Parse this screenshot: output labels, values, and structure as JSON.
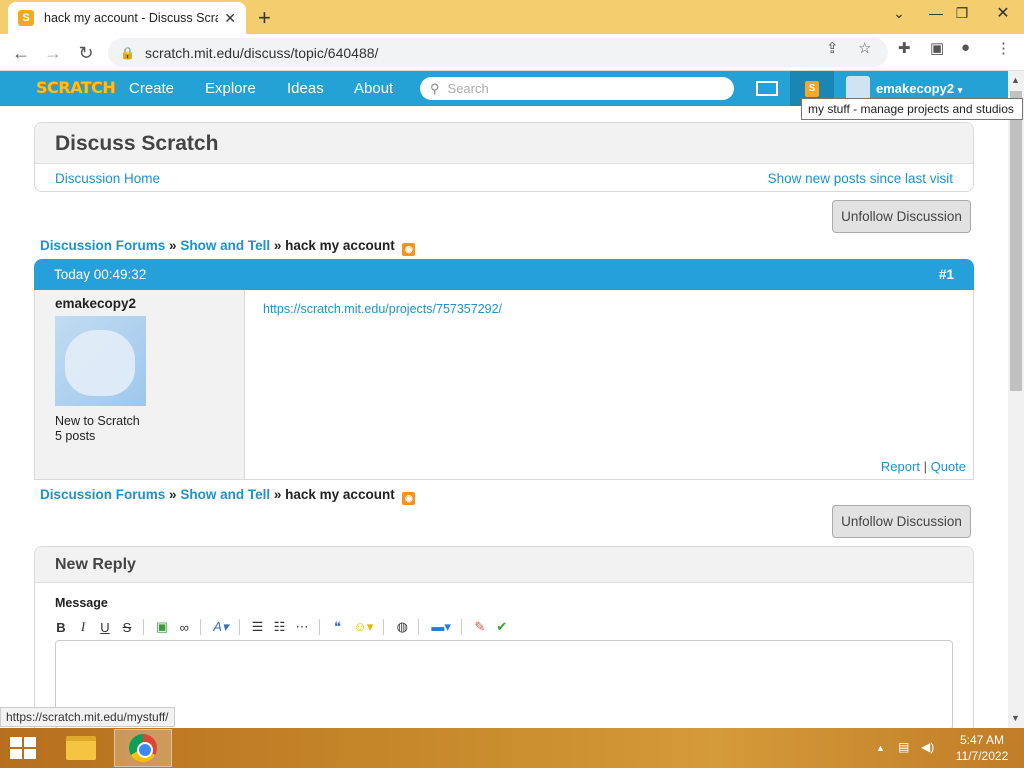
{
  "browser": {
    "tab_title": "hack my account - Discuss Scratc",
    "tab_favicon": "S",
    "url": "scratch.mit.edu/discuss/topic/640488/",
    "status_url": "https://scratch.mit.edu/mystuff/"
  },
  "nav": {
    "logo": "SCRATCH",
    "links": [
      "Create",
      "Explore",
      "Ideas",
      "About"
    ],
    "search_placeholder": "Search",
    "username": "emakecopy2",
    "tooltip": "my stuff - manage projects and studios"
  },
  "discuss": {
    "title": "Discuss Scratch",
    "home_link": "Discussion Home",
    "new_posts_link": "Show new posts since last visit",
    "unfollow_label": "Unfollow Discussion"
  },
  "breadcrumb": {
    "forums": "Discussion Forums",
    "sep": "»",
    "category": "Show and Tell",
    "topic": "hack my account"
  },
  "post": {
    "time": "Today 00:49:32",
    "number": "#1",
    "author": "emakecopy2",
    "rank": "New to Scratch",
    "post_count": "5 posts",
    "content_link": "https://scratch.mit.edu/projects/757357292/",
    "report": "Report",
    "action_sep": "|",
    "quote": "Quote"
  },
  "reply": {
    "title": "New Reply",
    "message_label": "Message"
  },
  "editor_toolbar": {
    "bold": "B",
    "italic": "I",
    "underline": "U",
    "strike": "S"
  },
  "taskbar": {
    "time": "5:47 AM",
    "date": "11/7/2022"
  },
  "colors": {
    "scratch_blue": "#25a2d5",
    "link": "#1d93c9",
    "chrome_tabbar": "#f3cd6e"
  }
}
